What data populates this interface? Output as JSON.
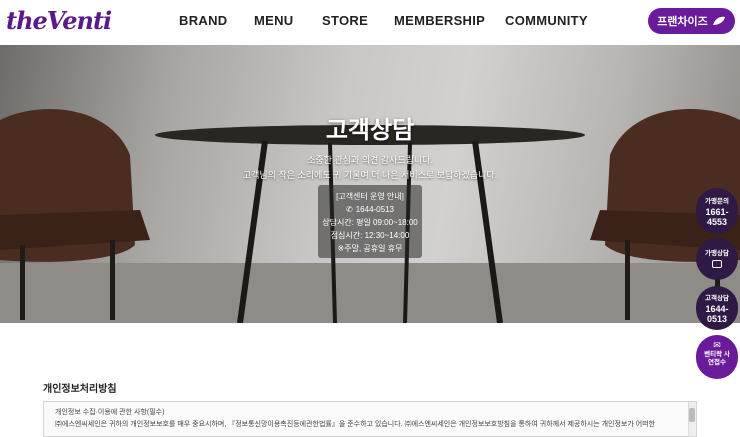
{
  "header": {
    "logo": "theVenti",
    "nav": [
      "BRAND",
      "MENU",
      "STORE",
      "MEMBERSHIP",
      "COMMUNITY"
    ],
    "franchise_button": "프랜차이즈"
  },
  "hero": {
    "title": "고객상담",
    "line1": "소중한 관심과 의견 감사드립니다.",
    "line2": "고객님의 작은 소리에도 귀 기울여 더 나은 서비스로 보답하겠습니다.",
    "info": {
      "heading": "[고객센터 운영 안내]",
      "phone": "1644-0513",
      "hours": "상담시간: 평일 09:00~18:00",
      "lunch": "점심시간: 12:30~14:00",
      "closed": "※주말, 공휴일 휴무"
    }
  },
  "side": {
    "franchise_call_label": "가맹문의",
    "franchise_call_number": "1661-4553",
    "franchise_chat_label": "가맹상담",
    "cs_label": "고객상담",
    "cs_number": "1644-0513",
    "venti_label": "벤티락 사연접수"
  },
  "policy": {
    "title": "개인정보처리방침",
    "line1": "개인정보 수집·이용에 관한 사항(필수)",
    "line2": "㈜에스엔씨세인은 귀하의 개인정보보호를 매우 중요시하며, 『정보통신망이용촉진등에관한법률』을 준수하고 있습니다. ㈜에스엔씨세인은 개인정보보호방침을 통하여 귀하께서 제공하시는 개인정보가 어떠한"
  },
  "colors": {
    "brand": "#6a1b9a",
    "side_dark": "#2e1a45"
  }
}
